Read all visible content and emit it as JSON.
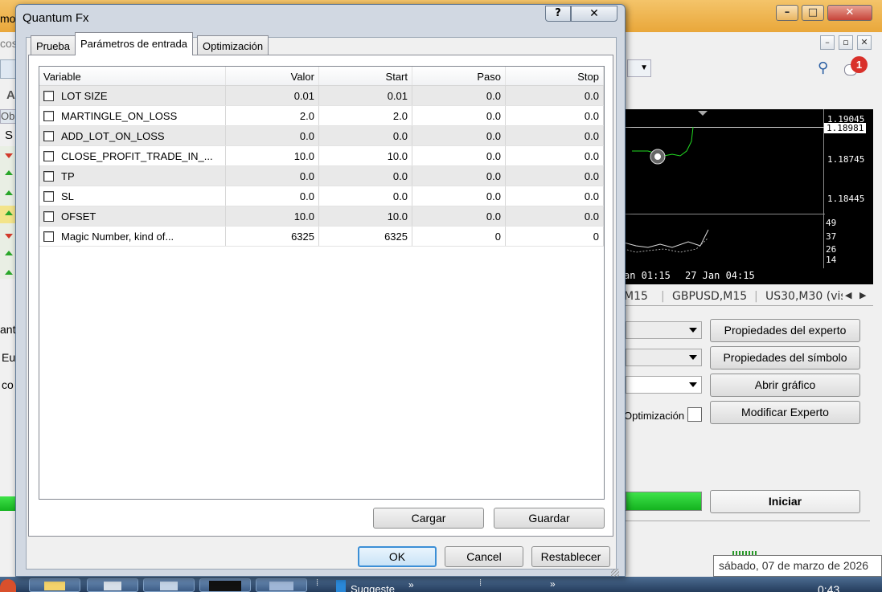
{
  "background": {
    "frag_title": "mo",
    "frag_menu": "cos",
    "frag_a": "A",
    "frag_ob": "Ob",
    "frag_s": "S",
    "frag_ant": "ant",
    "frag_eu": "Eu",
    "frag_co": "co",
    "notification_count": "1",
    "chart": {
      "prices": [
        "1.19045",
        "1.18981",
        "1.18745",
        "1.18445"
      ],
      "osc_levels": [
        "49",
        "37",
        "26",
        "14"
      ],
      "times": [
        "an 01:15",
        "27 Jan 04:15"
      ]
    },
    "chart_tabs": [
      "M15",
      "GBPUSD,M15",
      "US30,M30 (vis"
    ],
    "tester_buttons": {
      "expert_props": "Propiedades del experto",
      "symbol_props": "Propiedades del símbolo",
      "open_chart": "Abrir gráfico",
      "modify_expert": "Modificar Experto",
      "start": "Iniciar"
    },
    "optimization_label": "Optimización",
    "datetime_tooltip": "sábado, 07 de marzo de 2026",
    "taskbar": {
      "suggested": "Suggeste",
      "clock": "0:43"
    }
  },
  "dialog": {
    "title": "Quantum Fx",
    "help": "?",
    "close": "✕",
    "tabs": [
      "Prueba",
      "Parámetros de entrada",
      "Optimización"
    ],
    "columns": [
      "Variable",
      "Valor",
      "Start",
      "Paso",
      "Stop"
    ],
    "rows": [
      [
        "LOT SIZE",
        "0.01",
        "0.01",
        "0.0",
        "0.0"
      ],
      [
        "MARTINGLE_ON_LOSS",
        "2.0",
        "2.0",
        "0.0",
        "0.0"
      ],
      [
        "ADD_LOT_ON_LOSS",
        "0.0",
        "0.0",
        "0.0",
        "0.0"
      ],
      [
        "CLOSE_PROFIT_TRADE_IN_...",
        "10.0",
        "10.0",
        "0.0",
        "0.0"
      ],
      [
        "TP",
        "0.0",
        "0.0",
        "0.0",
        "0.0"
      ],
      [
        "SL",
        "0.0",
        "0.0",
        "0.0",
        "0.0"
      ],
      [
        "OFSET",
        "10.0",
        "10.0",
        "0.0",
        "0.0"
      ],
      [
        "Magic Number, kind of...",
        "6325",
        "6325",
        "0",
        "0"
      ]
    ],
    "load": "Cargar",
    "save": "Guardar",
    "ok": "OK",
    "cancel": "Cancel",
    "reset": "Restablecer"
  }
}
